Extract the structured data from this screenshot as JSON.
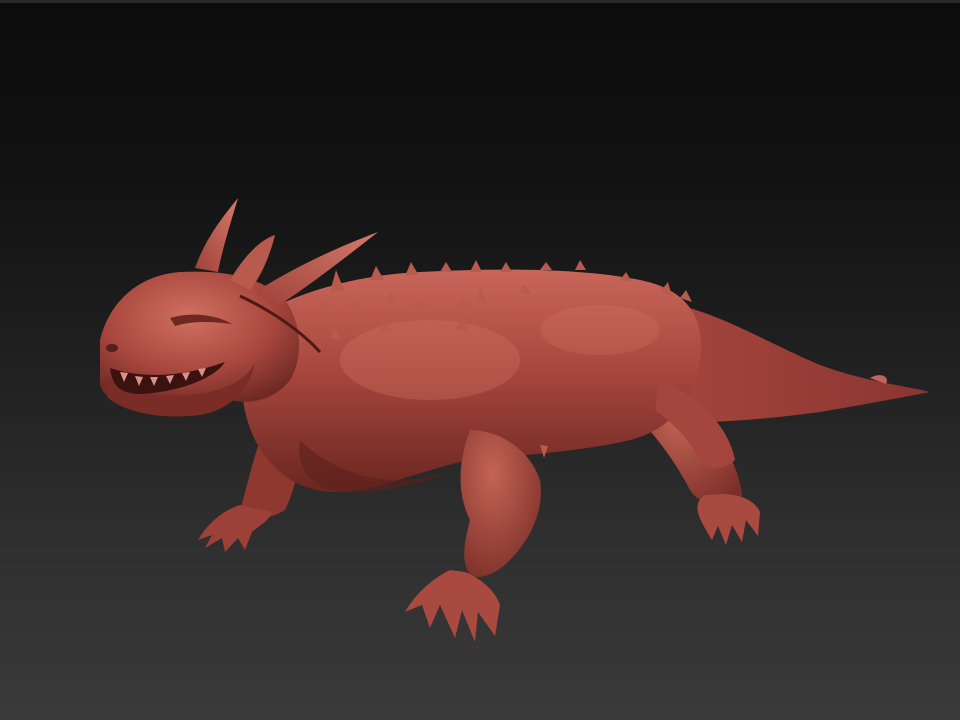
{
  "scene": {
    "subject": "creature-sculpt",
    "colors": {
      "background_top": "#0c0c0c",
      "background_bottom": "#3a3a3a",
      "clay_base": "#a0423a",
      "clay_light": "#cc6a5c",
      "clay_dark": "#5e211c"
    }
  }
}
